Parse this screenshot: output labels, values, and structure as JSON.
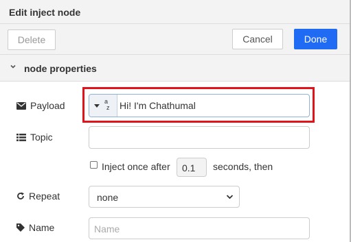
{
  "header": {
    "title": "Edit inject node"
  },
  "toolbar": {
    "delete_label": "Delete",
    "cancel_label": "Cancel",
    "done_label": "Done"
  },
  "section": {
    "label": "node properties"
  },
  "payload": {
    "label": "Payload",
    "type_icon": "az-string-icon",
    "value": "Hi! I'm Chathumal"
  },
  "topic": {
    "label": "Topic",
    "value": ""
  },
  "inject_once": {
    "checked": false,
    "label": "Inject once after",
    "seconds": "0.1",
    "suffix": "seconds, then"
  },
  "repeat": {
    "label": "Repeat",
    "selected": "none"
  },
  "name": {
    "label": "Name",
    "placeholder": "Name",
    "value": ""
  },
  "colors": {
    "accent": "#1f6bf3",
    "highlight": "#e0131a"
  }
}
